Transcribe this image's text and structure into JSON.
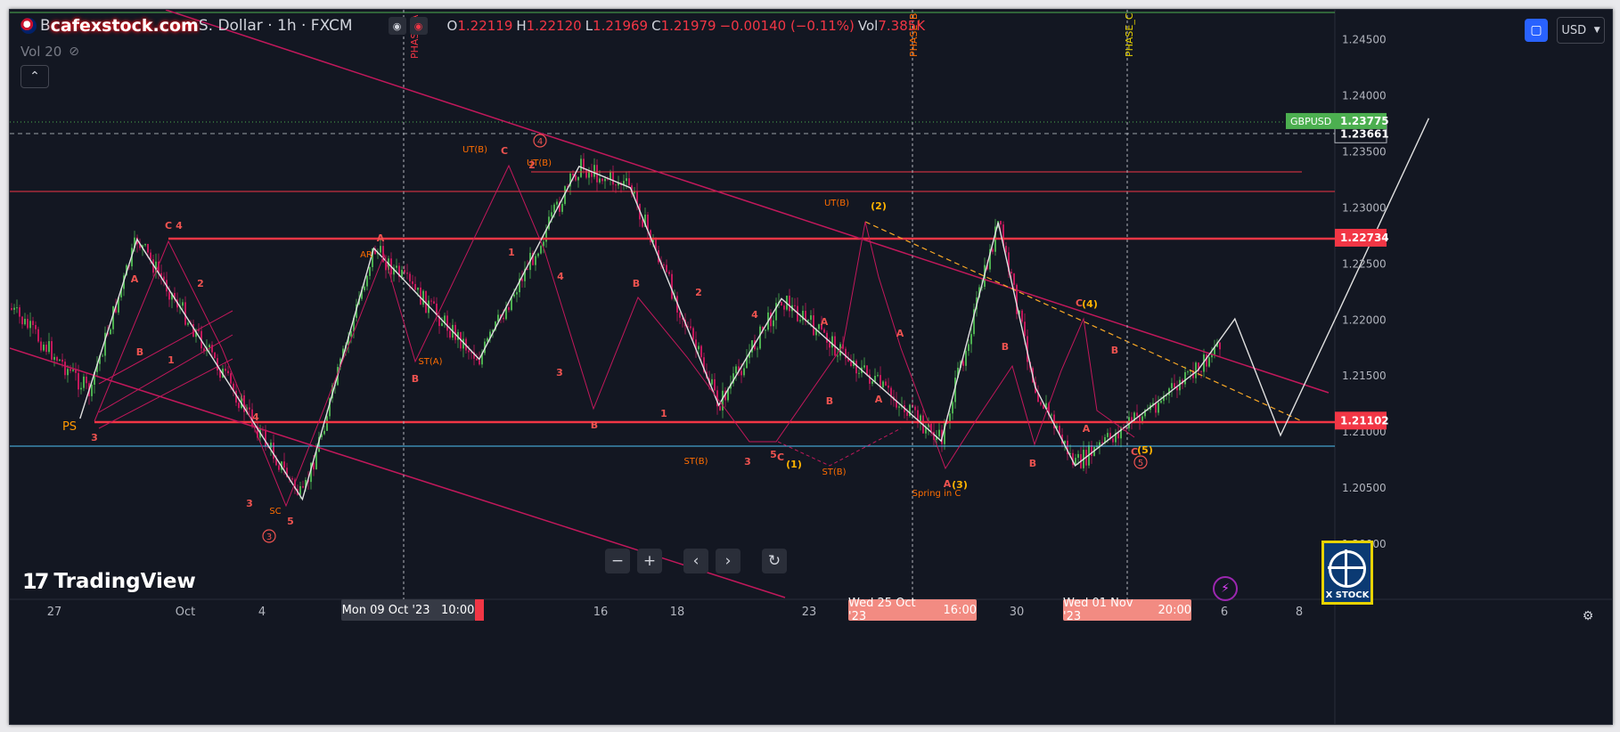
{
  "legend": {
    "watermark_site": "cafexstock.com",
    "symbol_prefix": "B",
    "symbol_suffix": "S. Dollar · 1h · FXCM",
    "ohlc": [
      {
        "k": "O",
        "v": "1.22119"
      },
      {
        "k": "H",
        "v": "1.22120"
      },
      {
        "k": "L",
        "v": "1.21969"
      },
      {
        "k": "C",
        "v": "1.21979"
      },
      {
        "k": "",
        "v": "−0.00140 (−0.11%)"
      },
      {
        "k": "Vol",
        "v": "7.385K"
      }
    ],
    "vol_indicator": "Vol 20"
  },
  "toolbar": {
    "currency": "USD"
  },
  "price_axis": {
    "ticks": [
      "1.24500",
      "1.24000",
      "1.23500",
      "1.23000",
      "1.22500",
      "1.22000",
      "1.21500",
      "1.21000",
      "1.20500",
      "1.20000"
    ],
    "badges": [
      {
        "text": "1.22734",
        "price": 1.22734,
        "color": "#f23645"
      },
      {
        "text": "1.21102",
        "price": 1.21102,
        "color": "#f23645"
      },
      {
        "text": "1.23661",
        "price": 1.23661,
        "color": "#131722"
      }
    ],
    "current": {
      "name": "GBPUSD",
      "value": "1.23775",
      "price": 1.23775,
      "color": "#4caf50"
    }
  },
  "time_axis": {
    "ticks": [
      "27",
      "Oct",
      "4",
      "16",
      "18",
      "23",
      "30",
      "6",
      "8"
    ],
    "highlights": [
      {
        "date": "Mon 09 Oct '23",
        "time": "10:00"
      },
      {
        "date": "Wed 25 Oct '23",
        "time": "16:00"
      },
      {
        "date": "Wed 01 Nov '23",
        "time": "20:00"
      }
    ]
  },
  "phases": [
    "PHASE_A",
    "PHASE_B",
    "PHASE_C"
  ],
  "annotations": {
    "wyckoff": [
      "PS",
      "SC",
      "AR",
      "ST(A)",
      "UT(B)",
      "UT(B)",
      "UT(B)",
      "ST(B)",
      "ST(B)",
      "Spring in C"
    ],
    "waves_red": [
      "C",
      "4",
      "A",
      "2",
      "B",
      "1",
      "3",
      "4",
      "3",
      "5",
      "A",
      "B",
      "C",
      "2",
      "1",
      "4",
      "3",
      "B",
      "B",
      "1",
      "2",
      "4",
      "3",
      "5",
      "C",
      "A",
      "B",
      "A",
      "A",
      "B",
      "B",
      "C",
      "A",
      "B",
      "C",
      "A"
    ],
    "waves_orange": [
      "(1)",
      "(2)",
      "(3)",
      "(4)",
      "(5)"
    ],
    "circled": [
      "3",
      "4",
      "5"
    ]
  },
  "branding": {
    "tradingview": "TradingView",
    "xstock": "X STOCK"
  },
  "chart_data": {
    "type": "candlestick",
    "symbol": "GBPUSD",
    "interval": "1h",
    "ylim": [
      1.1985,
      1.2455
    ],
    "x_range": [
      "2023-09-27",
      "2023-11-08"
    ],
    "horizontal_levels": [
      1.22734,
      1.21102,
      1.2315,
      1.2332,
      1.2087,
      1.23661
    ],
    "swing_path": [
      {
        "x": "2023-09-27 18:00",
        "y": 1.2112
      },
      {
        "x": "2023-09-29 10:00",
        "y": 1.2272
      },
      {
        "x": "2023-10-04 06:00",
        "y": 1.204
      },
      {
        "x": "2023-10-06 08:00",
        "y": 1.2264
      },
      {
        "x": "2023-10-09 10:00",
        "y": 1.2165
      },
      {
        "x": "2023-10-12 08:00",
        "y": 1.2337
      },
      {
        "x": "2023-10-13 20:00",
        "y": 1.2318
      },
      {
        "x": "2023-10-16 10:00",
        "y": 1.2124
      },
      {
        "x": "2023-10-18 06:00",
        "y": 1.2219
      },
      {
        "x": "2023-10-22 22:00",
        "y": 1.2092
      },
      {
        "x": "2023-10-24 14:00",
        "y": 1.2287
      },
      {
        "x": "2023-10-25 16:00",
        "y": 1.214
      },
      {
        "x": "2023-10-26 20:00",
        "y": 1.207
      },
      {
        "x": "2023-10-30 10:00",
        "y": 1.2155
      },
      {
        "x": "2023-10-31 12:00",
        "y": 1.2201
      },
      {
        "x": "2023-11-01 20:00",
        "y": 1.2097
      },
      {
        "x": "2023-11-03 10:00",
        "y": 1.22
      },
      {
        "x": "2023-11-06 04:00",
        "y": 1.238
      }
    ]
  }
}
